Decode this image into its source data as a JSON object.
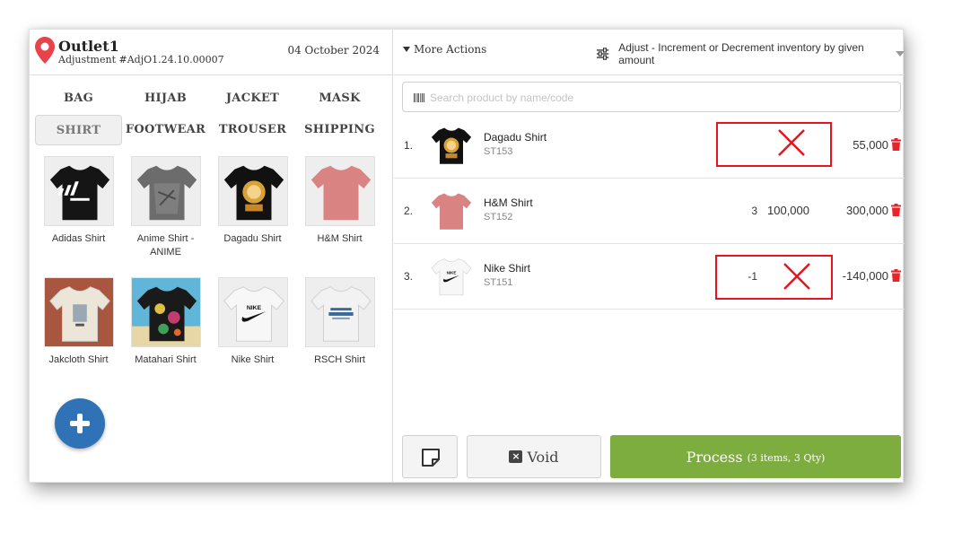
{
  "outlet": {
    "name": "Outlet1",
    "adjustment_number": "Adjustment #AdjO1.24.10.00007",
    "date": "04 October 2024"
  },
  "categories": [
    {
      "label": "BAG",
      "active": false
    },
    {
      "label": "HIJAB",
      "active": false
    },
    {
      "label": "JACKET",
      "active": false
    },
    {
      "label": "MASK",
      "active": false
    },
    {
      "label": "SHIRT",
      "active": true
    },
    {
      "label": "FOOTWEAR",
      "active": false
    },
    {
      "label": "TROUSER",
      "active": false
    },
    {
      "label": "SHIPPING",
      "active": false
    }
  ],
  "products": [
    {
      "name": "Adidas Shirt",
      "shirt_color": "#151515",
      "graphic": "adidas"
    },
    {
      "name": "Anime Shirt - ANIME",
      "shirt_color": "#6c6c6c",
      "graphic": "anime"
    },
    {
      "name": "Dagadu Shirt",
      "shirt_color": "#111111",
      "graphic": "dagadu"
    },
    {
      "name": "H&M Shirt",
      "shirt_color": "#d98383",
      "graphic": "plain"
    },
    {
      "name": "Jakcloth Shirt",
      "shirt_color": "#ece6d8",
      "graphic": "jakcloth"
    },
    {
      "name": "Matahari Shirt",
      "shirt_color": "#1a1a1a",
      "graphic": "floral"
    },
    {
      "name": "Nike Shirt",
      "shirt_color": "#f7f7f7",
      "graphic": "nike"
    },
    {
      "name": "RSCH Shirt",
      "shirt_color": "#f2f2f2",
      "graphic": "rsch"
    }
  ],
  "toolbar": {
    "more_actions": "More Actions",
    "adjust_mode": "Adjust - Increment or Decrement inventory by given amount"
  },
  "search": {
    "placeholder": "Search product by name/code",
    "value": ""
  },
  "line_items": [
    {
      "index": "1.",
      "name": "Dagadu Shirt",
      "code": "ST153",
      "qty": "",
      "price": "",
      "total": "55,000",
      "shirt_color": "#111111",
      "graphic": "dagadu",
      "flagged": true
    },
    {
      "index": "2.",
      "name": "H&M Shirt",
      "code": "ST152",
      "qty": "3",
      "price": "100,000",
      "total": "300,000",
      "shirt_color": "#d98383",
      "graphic": "plain",
      "flagged": false
    },
    {
      "index": "3.",
      "name": "Nike Shirt",
      "code": "ST151",
      "qty": "-1",
      "price": "",
      "total": "-140,000",
      "shirt_color": "#f7f7f7",
      "graphic": "nike",
      "flagged": true
    }
  ],
  "buttons": {
    "void_label": "Void",
    "process_label": "Process",
    "process_summary": "(3 items, 3 Qty)"
  },
  "colors": {
    "accent_green": "#7cad3e",
    "add_button_blue": "#2f72b5",
    "delete_red": "#e8232a",
    "pin_red": "#e8434a",
    "annotation_red": "#e8141e"
  }
}
